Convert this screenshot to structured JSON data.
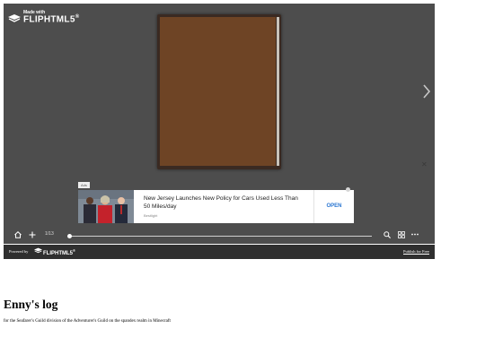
{
  "viewer": {
    "brand": {
      "caption": "Made with",
      "name": "FLIPHTML5",
      "trademark": "®"
    },
    "page_indicator": "1/13",
    "icons": [
      "book-logo-icon",
      "next-page-icon",
      "close-icon",
      "home-icon",
      "plus-icon",
      "search-icon",
      "thumbnails-icon",
      "more-icon"
    ],
    "slider": {
      "current_page": 1,
      "total_pages": 13
    },
    "colors": {
      "background": "#4d4d4d",
      "book_cover": "#6e4425",
      "footer": "#2f2f2f"
    }
  },
  "ad": {
    "label": "Ads",
    "headline": "New Jersey Launches New Policy for Cars Used Less Than 50 Miles/day",
    "source": "Bestlight",
    "cta": "OPEN",
    "cta_color": "#2a76d2"
  },
  "footer": {
    "powered_by": "Powered by",
    "brand_name": "FLIPHTML5",
    "trademark": "®",
    "publish_link": "Publish for Free"
  },
  "page": {
    "title": "Enny's log",
    "description": "for the Seafarer's Guild division of the Adventurer's Guild on the spandex realm in Minecraft"
  }
}
